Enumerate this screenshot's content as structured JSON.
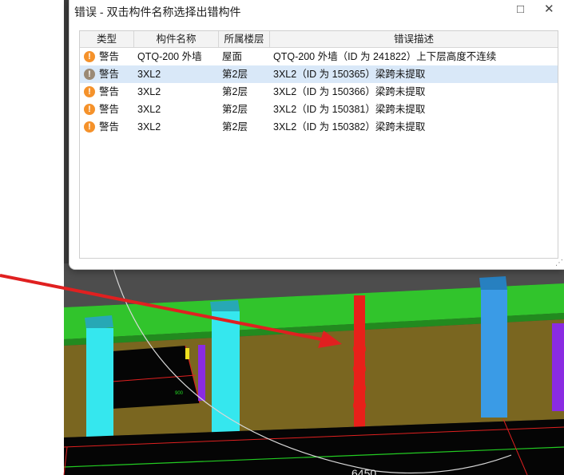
{
  "dialog": {
    "title": "错误 - 双击构件名称选择出错构件",
    "maximize_icon": "□",
    "close_icon": "✕"
  },
  "table": {
    "columns": [
      "类型",
      "构件名称",
      "所属楼层",
      "错误描述"
    ],
    "rows": [
      {
        "icon": "warning-icon",
        "type": "警告",
        "name": "QTQ-200 外墙",
        "floor": "屋面",
        "desc": "QTQ-200 外墙（ID 为 241822）上下层高度不连续",
        "selected": false
      },
      {
        "icon": "warning-icon",
        "type": "警告",
        "name": "3XL2",
        "floor": "第2层",
        "desc": "3XL2（ID 为 150365）梁跨未提取",
        "selected": true
      },
      {
        "icon": "warning-icon",
        "type": "警告",
        "name": "3XL2",
        "floor": "第2层",
        "desc": "3XL2（ID 为 150366）梁跨未提取",
        "selected": false
      },
      {
        "icon": "warning-icon",
        "type": "警告",
        "name": "3XL2",
        "floor": "第2层",
        "desc": "3XL2（ID 为 150381）梁跨未提取",
        "selected": false
      },
      {
        "icon": "warning-icon",
        "type": "警告",
        "name": "3XL2",
        "floor": "第2层",
        "desc": "3XL2（ID 为 150382）梁跨未提取",
        "selected": false
      }
    ]
  },
  "viewport": {
    "labels": [
      "900",
      "6450"
    ]
  },
  "colors": {
    "warning": "#f5922b",
    "warning_selected": "#9b8a76",
    "selection": "#d9e8f8",
    "annotation_arrow": "#e02020"
  }
}
